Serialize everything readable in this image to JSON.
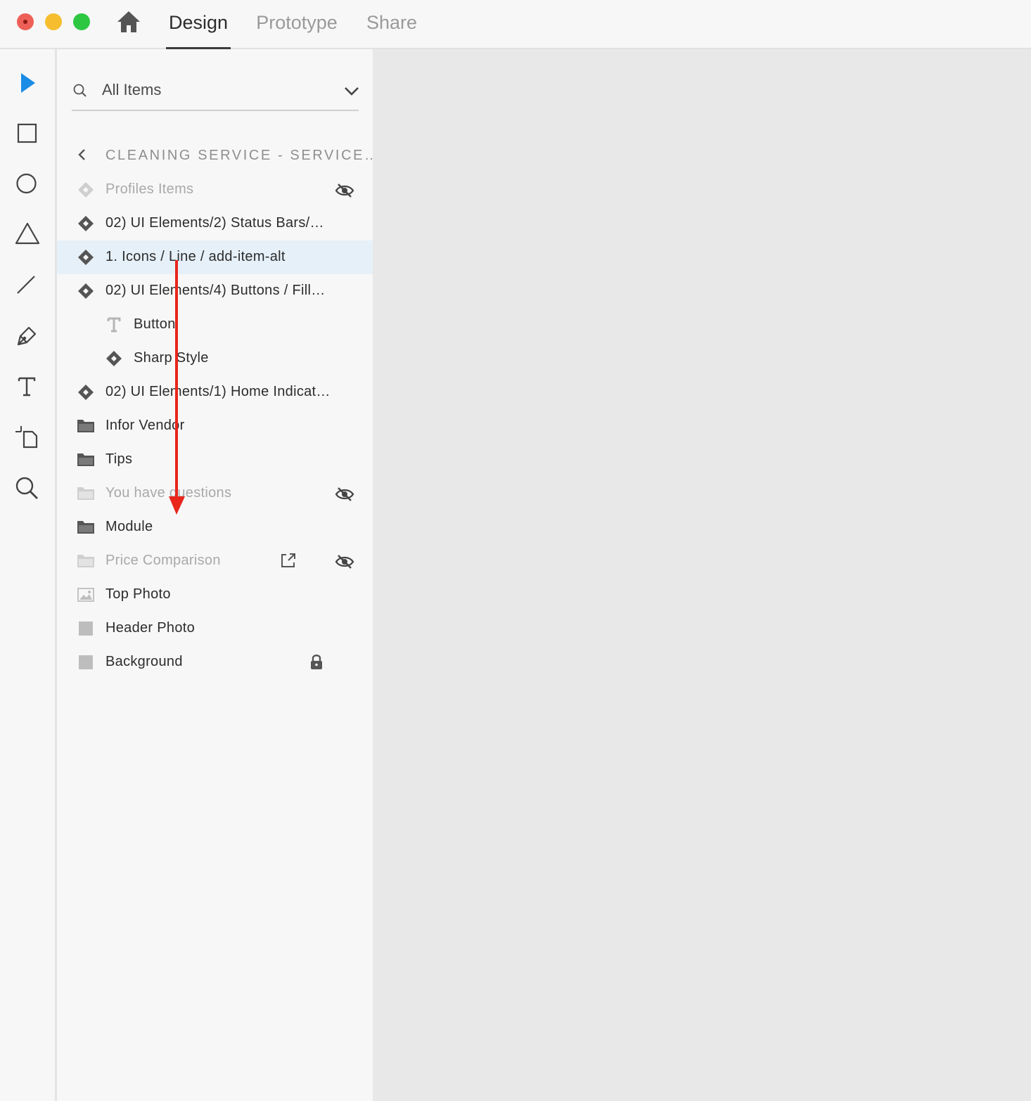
{
  "tabs": {
    "design": "Design",
    "prototype": "Prototype",
    "share": "Share"
  },
  "search": {
    "label": "All Items"
  },
  "breadcrumb": "CLEANING SERVICE - SERVICE…",
  "layers": [
    {
      "label": "Profiles Items",
      "type": "component",
      "hidden": true
    },
    {
      "label": "02) UI Elements/2) Status Bars/…",
      "type": "component"
    },
    {
      "label": "1. Icons / Line /  add-item-alt",
      "type": "component",
      "selected": true
    },
    {
      "label": "02) UI Elements/4) Buttons / Fill…",
      "type": "component"
    },
    {
      "label": "Button",
      "type": "text",
      "indent": true
    },
    {
      "label": "Sharp Style",
      "type": "component",
      "indent": true
    },
    {
      "label": "02) UI Elements/1) Home Indicat…",
      "type": "component"
    },
    {
      "label": "Infor Vendor",
      "type": "group"
    },
    {
      "label": "Tips",
      "type": "group"
    },
    {
      "label": "You have questions",
      "type": "group",
      "hidden": true
    },
    {
      "label": "Module",
      "type": "group"
    },
    {
      "label": "Price Comparison",
      "type": "group",
      "hidden": true,
      "external": true
    },
    {
      "label": "Top Photo",
      "type": "image"
    },
    {
      "label": "Header Photo",
      "type": "rectangle"
    },
    {
      "label": "Background",
      "type": "rectangle",
      "locked": true
    }
  ],
  "colors": {
    "accent": "#1a8ce6",
    "annotation": "#e8261c",
    "selected_row": "#e6f0f8"
  }
}
